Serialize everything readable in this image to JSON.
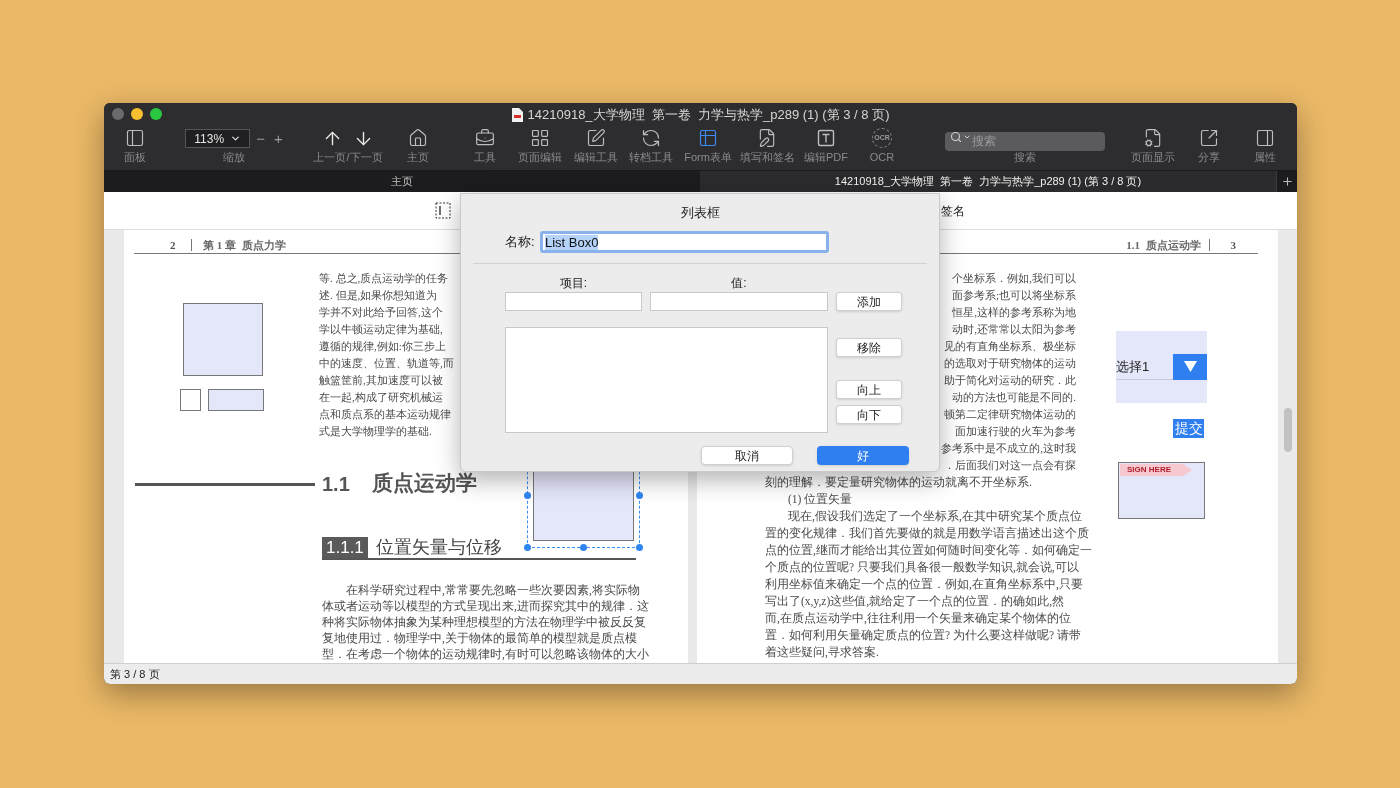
{
  "window": {
    "title": "14210918_大学物理  第一卷  力学与热学_p289 (1) (第 3 / 8 页)",
    "traffic_lights": [
      {
        "color": "#6b6b6d"
      },
      {
        "color": "#f5bf2f"
      },
      {
        "color": "#2ac840"
      }
    ]
  },
  "toolbar": [
    {
      "kind": "button",
      "label": "面板",
      "selected": false
    },
    {
      "kind": "zoom",
      "label": "缩放",
      "value": "113%",
      "minus": "−",
      "plus": "+"
    },
    {
      "kind": "nav",
      "label": "上一页/下一页"
    },
    {
      "kind": "button",
      "label": "主页",
      "selected": false
    },
    {
      "kind": "button",
      "label": "工具",
      "selected": false
    },
    {
      "kind": "button",
      "label": "页面编辑",
      "selected": false
    },
    {
      "kind": "button",
      "label": "编辑工具",
      "selected": false
    },
    {
      "kind": "button",
      "label": "转档工具",
      "selected": false
    },
    {
      "kind": "button",
      "label": "Form表单",
      "selected": true
    },
    {
      "kind": "button",
      "label": "填写和签名",
      "selected": false
    },
    {
      "kind": "button",
      "label": "编辑PDF",
      "selected": false
    },
    {
      "kind": "ocr",
      "label": "OCR",
      "icon_text": "OCR",
      "selected": false
    },
    {
      "kind": "search",
      "label": "搜索",
      "placeholder": "搜索"
    },
    {
      "kind": "button",
      "label": "页面显示",
      "selected": false
    },
    {
      "kind": "button",
      "label": "分享",
      "selected": false
    },
    {
      "kind": "button",
      "label": "属性",
      "selected": false
    }
  ],
  "tabs": [
    {
      "label": "主页",
      "selected": false
    },
    {
      "label": "14210918_大学物理  第一卷  力学与热学_p289 (1) (第 3 / 8 页)",
      "selected": true
    }
  ],
  "form_toolbar": {
    "item_text": "签名"
  },
  "left_page": {
    "header": {
      "page_number": "2",
      "chapter": "第 1 章  质点力学"
    },
    "lines": [
      "等. 总之,质点运动学的任务",
      "述. 但是,如果你想知道为",
      "学并不对此给予回答,这个",
      "学以牛顿运动定律为基础,",
      "遵循的规律,例如:你三步上",
      "中的速度、位置、轨道等,而",
      "触篮筐前,其加速度可以被",
      "在一起,构成了研究机械运",
      "点和质点系的基本运动规律",
      "式是大学物理学的基础."
    ],
    "heading": {
      "number": "1.1",
      "title": "质点运动学"
    },
    "form_field": {
      "selected": true
    },
    "subheading": {
      "number": "1.1.1",
      "title": "位置矢量与位移"
    },
    "paragraph": [
      {
        "kind": "indent",
        "text": "在科学研究过程中,常常要先忽略一些次要因素,将实际物"
      },
      {
        "kind": "line",
        "text": "体或者运动等以模型的方式呈现出来,进而探究其中的规律．这"
      },
      {
        "kind": "line",
        "text": "种将实际物体抽象为某种理想模型的方法在物理学中被反反复"
      },
      {
        "kind": "line",
        "text": "复地使用过．物理学中,关于物体的最简单的模型就是质点模"
      },
      {
        "kind": "line",
        "text": "型．在考虑一个物体的运动规律时,有时可以忽略该物体的大小"
      }
    ]
  },
  "right_page": {
    "header": {
      "section": "1.1  质点运动学",
      "page_number": "3"
    },
    "lines": [
      {
        "kind": "partial",
        "text": "个坐标系．例如,我们可以"
      },
      {
        "kind": "partial",
        "text": "面参考系;也可以将坐标系"
      },
      {
        "kind": "partial",
        "text": "恒星,这样的参考系称为地"
      },
      {
        "kind": "partial",
        "text": "动时,还常常以太阳为参考"
      },
      {
        "kind": "partial",
        "text": "见的有直角坐标系、极坐标"
      },
      {
        "kind": "partial",
        "text": "的选取对于研究物体的运动"
      },
      {
        "kind": "partial",
        "text": "助于简化对运动的研究．此"
      },
      {
        "kind": "partial",
        "text": "动的方法也可能是不同的."
      },
      {
        "kind": "partial",
        "text": "顿第二定律研究物体运动的"
      },
      {
        "kind": "partial",
        "text": "面加速行驶的火车为参考"
      },
      {
        "kind": "partial",
        "text": "参考系中是不成立的,这时我"
      },
      {
        "kind": "partial",
        "text": "．后面我们对这一点会有探"
      },
      {
        "kind": "line",
        "text": "刻的理解．要定量研究物体的运动就离不开坐标系."
      },
      {
        "kind": "indent",
        "text": "(1) 位置矢量"
      },
      {
        "kind": "indent",
        "text": "现在,假设我们选定了一个坐标系,在其中研究某个质点位"
      },
      {
        "kind": "line",
        "text": "置的变化规律．我们首先要做的就是用数学语言描述出这个质"
      },
      {
        "kind": "line",
        "text": "点的位置,继而才能给出其位置如何随时间变化等．如何确定一"
      },
      {
        "kind": "line",
        "text": "个质点的位置呢? 只要我们具备很一般数学知识,就会说,可以"
      },
      {
        "kind": "line",
        "text": "利用坐标值来确定一个点的位置．例如,在直角坐标系中,只要"
      },
      {
        "kind": "line",
        "text": "写出了(x,y,z)这些值,就给定了一个点的位置．的确如此,然"
      },
      {
        "kind": "line",
        "text": "而,在质点运动学中,往往利用一个矢量来确定某个物体的位"
      },
      {
        "kind": "line",
        "text": "置．如何利用矢量确定质点的位置? 为什么要这样做呢? 请带"
      },
      {
        "kind": "line",
        "text": "着这些疑问,寻求答案."
      }
    ],
    "dropdown": {
      "value": "选择1"
    },
    "submit": "提交",
    "signature": "SIGN HERE"
  },
  "dialog": {
    "title": "列表框",
    "name_label": "名称:",
    "name_value": "List Box0",
    "name_selected": true,
    "item_label": "项目:",
    "value_label": "值:",
    "add_button": "添加",
    "side_buttons": [
      "移除",
      "向上",
      "向下"
    ],
    "footer_buttons": [
      {
        "label": "取消",
        "default": false
      },
      {
        "label": "好",
        "default": true
      }
    ]
  },
  "status_bar": {
    "text": "第 3 / 8 页"
  }
}
